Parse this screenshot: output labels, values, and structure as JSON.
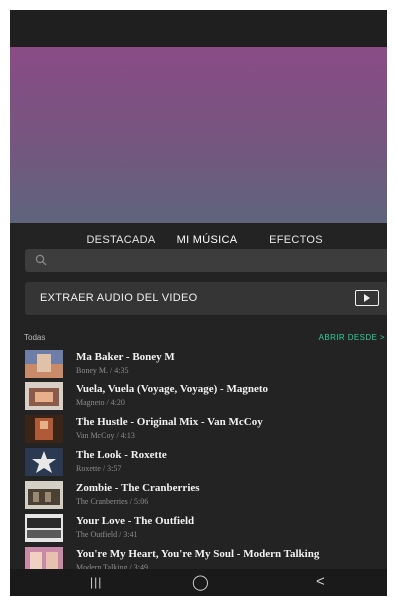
{
  "tabs": [
    "DESTACADA",
    "MI MÚSICA",
    "EFECTOS"
  ],
  "active_tab": 1,
  "search": {
    "placeholder": ""
  },
  "extract": {
    "label": "EXTRAER AUDIO DEL VIDEO"
  },
  "list_header": {
    "all_label": "Todas",
    "open_label": "ABRIR DESDE >"
  },
  "tracks": [
    {
      "title": "Ma Baker - Boney M",
      "sub": "Boney M. / 4:35"
    },
    {
      "title": "Vuela, Vuela (Voyage, Voyage) - Magneto",
      "sub": "Magneto / 4:20"
    },
    {
      "title": "The Hustle - Original Mix - Van McCoy",
      "sub": "Van McCoy / 4:13"
    },
    {
      "title": "The Look - Roxette",
      "sub": "Roxette / 3:57"
    },
    {
      "title": "Zombie - The Cranberries",
      "sub": "The Cranberries / 5:06"
    },
    {
      "title": "Your Love - The Outfield",
      "sub": "The Outfield / 3:41"
    },
    {
      "title": "You're My Heart, You're My Soul - Modern Talking",
      "sub": "Modern Talking / 3:49"
    }
  ],
  "nav": {
    "recents": "|||",
    "home": "◯",
    "back": "<"
  },
  "colors": {
    "accent": "#2fcf9b",
    "background": "#232323"
  }
}
